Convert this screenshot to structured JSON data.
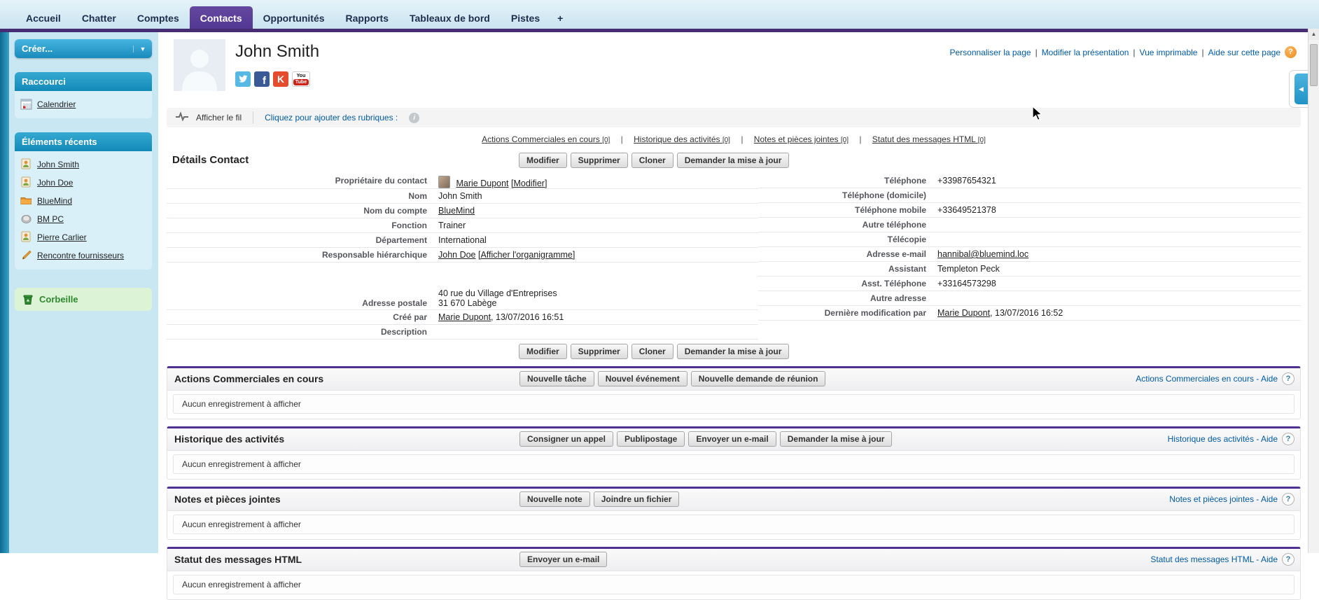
{
  "sep": "|",
  "nav": {
    "tabs": [
      "Accueil",
      "Chatter",
      "Comptes",
      "Contacts",
      "Opportunités",
      "Rapports",
      "Tableaux de bord",
      "Pistes"
    ],
    "active_tab": "Contacts",
    "more_tab": "+"
  },
  "sidebar": {
    "create_button": "Créer...",
    "shortcut_title": "Raccourci",
    "shortcut_item": "Calendrier",
    "recent_title": "Éléments récents",
    "recent_items": [
      {
        "label": "John Smith",
        "icon": "contact-icon"
      },
      {
        "label": "John Doe",
        "icon": "contact-icon"
      },
      {
        "label": "BlueMind",
        "icon": "folder-icon"
      },
      {
        "label": "BM PC",
        "icon": "coin-icon"
      },
      {
        "label": "Pierre Carlier",
        "icon": "contact-icon"
      },
      {
        "label": "Rencontre fournisseurs",
        "icon": "pencil-icon"
      }
    ],
    "recycle_bin": "Corbeille"
  },
  "header": {
    "title": "John Smith",
    "page_links": [
      "Personnaliser la page",
      "Modifier la présentation",
      "Vue imprimable",
      "Aide sur cette page"
    ],
    "help_badge": "?",
    "facebook_letter": "f",
    "klout_letter": "K",
    "youtube_top": "You",
    "youtube_bottom": "Tube"
  },
  "feed_bar": {
    "show_feed": "Afficher le fil",
    "add_topics": "Cliquez pour ajouter des rubriques :",
    "info_glyph": "i"
  },
  "jump_links": [
    {
      "label": "Actions Commerciales en cours",
      "count": "[0]"
    },
    {
      "label": "Historique des activités",
      "count": "[0]"
    },
    {
      "label": "Notes et pièces jointes",
      "count": "[0]"
    },
    {
      "label": "Statut des messages HTML",
      "count": "[0]"
    }
  ],
  "details": {
    "title": "Détails Contact",
    "buttons": [
      "Modifier",
      "Supprimer",
      "Cloner",
      "Demander la mise à jour"
    ],
    "fields": {
      "owner_label": "Propriétaire du contact",
      "owner_name": "Marie Dupont",
      "owner_modify": "[Modifier]",
      "name_label": "Nom",
      "name_value": "John Smith",
      "account_label": "Nom du compte",
      "account_value": "BlueMind",
      "function_label": "Fonction",
      "function_value": "Trainer",
      "dept_label": "Département",
      "dept_value": "International",
      "manager_label": "Responsable hiérarchique",
      "manager_name": "John Doe",
      "manager_org": "[Afficher l'organigramme]",
      "mailing_label": "Adresse postale",
      "mailing_line1": "40 rue du Village d'Entreprises",
      "mailing_line2": "31 670 Labège",
      "created_label": "Créé par",
      "created_by": "Marie Dupont",
      "created_suffix": ", 13/07/2016 16:51",
      "description_label": "Description",
      "phone_label": "Téléphone",
      "phone_value": "+33987654321",
      "home_phone_label": "Téléphone (domicile)",
      "mobile_label": "Téléphone mobile",
      "mobile_value": "+33649521378",
      "other_phone_label": "Autre téléphone",
      "fax_label": "Télécopie",
      "email_label": "Adresse e-mail",
      "email_value": "hannibal@bluemind.loc",
      "assistant_label": "Assistant",
      "assistant_value": "Templeton Peck",
      "asst_phone_label": "Asst. Téléphone",
      "asst_phone_value": "+33164573298",
      "other_address_label": "Autre adresse",
      "modified_label": "Dernière modification par",
      "modified_by": "Marie Dupont",
      "modified_suffix": ", 13/07/2016 16:52"
    }
  },
  "sections": [
    {
      "title": "Actions Commerciales en cours",
      "buttons": [
        "Nouvelle tâche",
        "Nouvel événement",
        "Nouvelle demande de réunion"
      ],
      "help_link": "Actions Commerciales en cours - Aide",
      "help_glyph": "?",
      "empty": "Aucun enregistrement à afficher"
    },
    {
      "title": "Historique des activités",
      "buttons": [
        "Consigner un appel",
        "Publipostage",
        "Envoyer un e-mail",
        "Demander la mise à jour"
      ],
      "help_link": "Historique des activités - Aide",
      "help_glyph": "?",
      "empty": "Aucun enregistrement à afficher"
    },
    {
      "title": "Notes et pièces jointes",
      "buttons": [
        "Nouvelle note",
        "Joindre un fichier"
      ],
      "help_link": "Notes et pièces jointes - Aide",
      "help_glyph": "?",
      "empty": "Aucun enregistrement à afficher"
    },
    {
      "title": "Statut des messages HTML",
      "buttons": [
        "Envoyer un e-mail"
      ],
      "help_link": "Statut des messages HTML - Aide",
      "help_glyph": "?",
      "empty": "Aucun enregistrement à afficher"
    }
  ]
}
